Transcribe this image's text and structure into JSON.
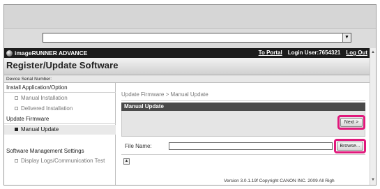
{
  "browser": {
    "address_value": "",
    "dropdown_glyph": "▼"
  },
  "header": {
    "brand": "imageRUNNER ADVANCE",
    "to_portal": "To Portal",
    "login_user": "Login User:7654321",
    "log_out": "Log Out"
  },
  "page": {
    "title": "Register/Update Software",
    "device_serial_label": "Device Serial Number:"
  },
  "sidebar": {
    "sections": [
      {
        "label": "Install Application/Option",
        "items": [
          "Manual Installation",
          "Delivered Installation"
        ]
      },
      {
        "label": "Update Firmware",
        "items": [
          "Manual Update"
        ],
        "active_item": "Manual Update"
      },
      {
        "label": "Software Management Settings",
        "items": [
          "Display Logs/Communication Test"
        ]
      }
    ]
  },
  "main": {
    "breadcrumb": "Update Firmware > Manual Update",
    "panel_title": "Manual Update",
    "next_button": "Next >",
    "file_name_label": "File Name:",
    "file_value": "",
    "browse_button": "Browse...",
    "top_icon_glyph": "▲"
  },
  "footer": {
    "text": "Version 3.0.1.19f Copyright CANON INC. 2009 All Righ"
  },
  "colors": {
    "highlight": "#e0197c",
    "brandbar": "#1c1c1c",
    "panel_head": "#4a4a4a"
  }
}
